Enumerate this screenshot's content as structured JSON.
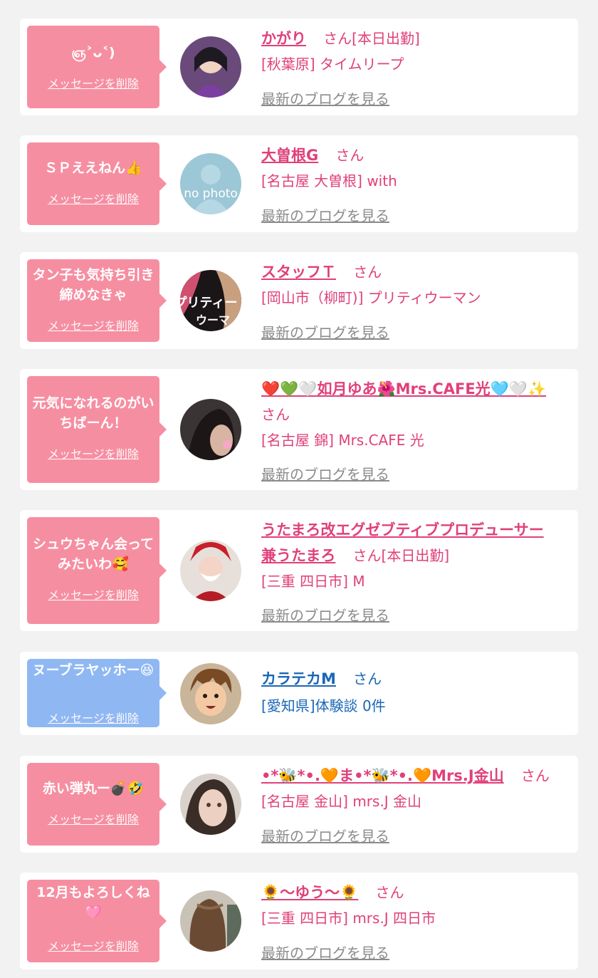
{
  "entries": [
    {
      "message": "ஞ˃ᴗ˂)",
      "delete_label": "メッセージを削除",
      "name": "かがり",
      "honorific": "さん[本日出勤]",
      "shop": "[秋葉原] タイムリープ",
      "blog_label": "最新のブログを見る"
    },
    {
      "message": "ＳＰええねん👍",
      "delete_label": "メッセージを削除",
      "name": "大曽根G",
      "honorific": "さん",
      "shop": "[名古屋 大曽根] with",
      "blog_label": "最新のブログを見る"
    },
    {
      "message": "タン子も気持ち引き締めなきゃ",
      "delete_label": "メッセージを削除",
      "name": "スタッフＴ",
      "honorific": "さん",
      "shop": "[岡山市（柳町)] プリティウーマン",
      "blog_label": "最新のブログを見る"
    },
    {
      "message": "元気になれるのがいちばーん！",
      "delete_label": "メッセージを削除",
      "name": "❤️💚🤍如月ゆあ🌺Mrs.CAFE光🩵🤍✨",
      "honorific": "さん",
      "shop": "[名古屋 錦] Mrs.CAFE 光",
      "blog_label": "最新のブログを見る"
    },
    {
      "message": "シュウちゃん会ってみたいわ🥰",
      "delete_label": "メッセージを削除",
      "name_line1": "うたまろ改エグゼブティブプロデューサー",
      "name_line2": "兼うたまろ",
      "honorific": "さん[本日出勤]",
      "shop": "[三重 四日市] M",
      "blog_label": "最新のブログを見る"
    },
    {
      "message": "ヌーブラヤッホー😆",
      "delete_label": "メッセージを削除",
      "name": "カラテカM",
      "honorific": "さん",
      "shop": "[愛知県]体験談 0件"
    },
    {
      "message": "赤い弾丸ー💣🤣",
      "delete_label": "メッセージを削除",
      "name": "•*🐝*•.🧡ま•*🐝*•.🧡Mrs.J金山",
      "honorific": "さん",
      "shop": "[名古屋 金山] mrs.J 金山",
      "blog_label": "最新のブログを見る"
    },
    {
      "message": "12月もよろしくね🩷",
      "delete_label": "メッセージを削除",
      "name": "🌻～ゆう～🌻",
      "honorific": "さん",
      "shop": "[三重 四日市] mrs.J 四日市",
      "blog_label": "最新のブログを見る"
    }
  ],
  "avatars": [
    "photo-avatar",
    "no-photo-avatar",
    "manga-avatar",
    "photo-avatar",
    "photo-avatar",
    "anime-avatar",
    "photo-avatar",
    "photo-avatar"
  ],
  "colors": {
    "pink_bubble": "#f68ea1",
    "blue_bubble": "#8fb8f3",
    "name_pink": "#e0407a",
    "name_blue": "#1a67b7",
    "blog_gray": "#8b8b8b"
  }
}
